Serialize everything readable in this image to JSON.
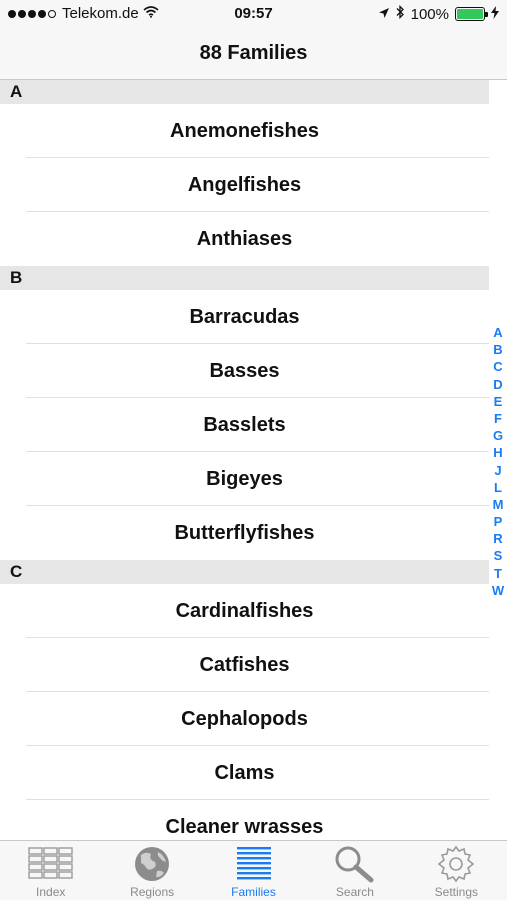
{
  "status_bar": {
    "carrier": "Telekom.de",
    "time": "09:57",
    "battery": "100%"
  },
  "nav": {
    "title": "88 Families"
  },
  "sections": [
    {
      "letter": "A",
      "items": [
        "Anemonefishes",
        "Angelfishes",
        "Anthiases"
      ]
    },
    {
      "letter": "B",
      "items": [
        "Barracudas",
        "Basses",
        "Basslets",
        "Bigeyes",
        "Butterflyfishes"
      ]
    },
    {
      "letter": "C",
      "items": [
        "Cardinalfishes",
        "Catfishes",
        "Cephalopods",
        "Clams",
        "Cleaner wrasses"
      ]
    }
  ],
  "index_letters": [
    "A",
    "B",
    "C",
    "D",
    "E",
    "F",
    "G",
    "H",
    "J",
    "L",
    "M",
    "P",
    "R",
    "S",
    "T",
    "W"
  ],
  "tabs": [
    {
      "label": "Index",
      "icon": "grid-icon"
    },
    {
      "label": "Regions",
      "icon": "globe-icon"
    },
    {
      "label": "Families",
      "icon": "list-icon",
      "active": true
    },
    {
      "label": "Search",
      "icon": "magnifier-icon"
    },
    {
      "label": "Settings",
      "icon": "gear-icon"
    }
  ],
  "colors": {
    "accent": "#1a7cf5",
    "battery": "#34c759"
  }
}
